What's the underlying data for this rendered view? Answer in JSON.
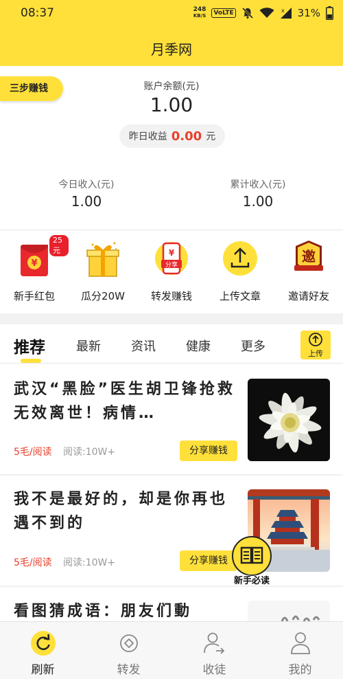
{
  "status_bar": {
    "time": "08:37",
    "net_speed_value": "248",
    "net_speed_unit": "KB/S",
    "volte": "VoLTE",
    "battery": "31%"
  },
  "header": {
    "title": "月季网"
  },
  "account": {
    "three_steps_label": "三步赚钱",
    "balance_label": "账户余额(元)",
    "balance_value": "1.00",
    "yesterday_label": "昨日收益",
    "yesterday_value": "0.00",
    "yesterday_unit": "元",
    "today_label": "今日收入(元)",
    "today_value": "1.00",
    "total_label": "累计收入(元)",
    "total_value": "1.00"
  },
  "functions": [
    {
      "label": "新手红包",
      "badge": "25元",
      "icon": "red-envelope-icon"
    },
    {
      "label": "瓜分20W",
      "icon": "gift-box-icon"
    },
    {
      "label": "转发赚钱",
      "icon": "phone-share-icon",
      "icon_text": "分享"
    },
    {
      "label": "上传文章",
      "icon": "upload-icon"
    },
    {
      "label": "邀请好友",
      "icon": "invite-icon",
      "icon_text": "邀"
    }
  ],
  "tabs": [
    {
      "label": "推荐",
      "active": true
    },
    {
      "label": "最新"
    },
    {
      "label": "资讯"
    },
    {
      "label": "健康"
    },
    {
      "label": "更多"
    }
  ],
  "upload_button_label": "上传",
  "articles": [
    {
      "title": "武汉“黑脸”医生胡卫锋抢救无效离世！病情…",
      "price": "5毛/阅读",
      "reads": "阅读:10W+",
      "share_label": "分享赚钱"
    },
    {
      "title": "我不是最好的，却是你再也遇不到的",
      "price": "5毛/阅读",
      "reads": "阅读:10W+",
      "share_label": "分享赚钱"
    },
    {
      "title": "看图猜成语：朋友们動"
    }
  ],
  "float_guide_label": "新手必读",
  "bottom_nav": [
    {
      "label": "刷新",
      "active": true,
      "icon": "refresh-icon"
    },
    {
      "label": "转发",
      "icon": "share-diamond-icon"
    },
    {
      "label": "收徒",
      "icon": "add-follower-icon"
    },
    {
      "label": "我的",
      "icon": "profile-icon"
    }
  ],
  "colors": {
    "accent": "#ffe03a",
    "red": "#e8402c"
  }
}
